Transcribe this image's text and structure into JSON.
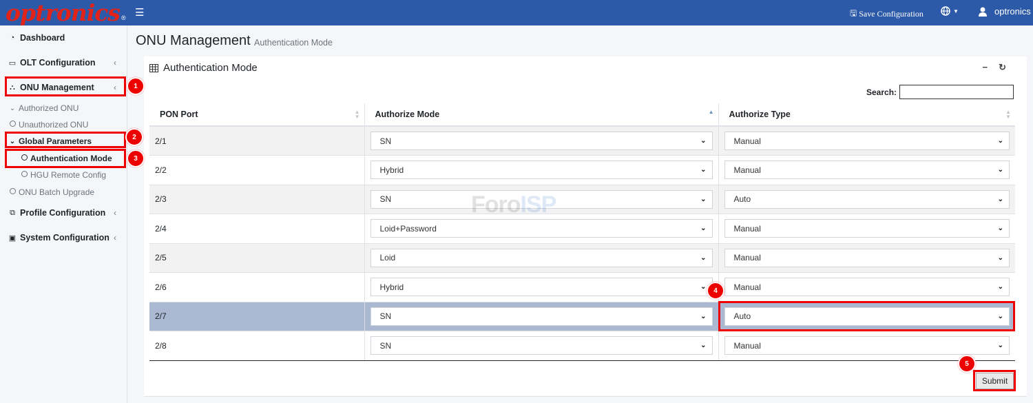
{
  "brand": {
    "logo_text": "optronics",
    "logo_mark": "®"
  },
  "header": {
    "save_label": "Save Configuration",
    "user_name": "optronics"
  },
  "sidebar": {
    "items": [
      {
        "label": "Dashboard",
        "icon": "tachometer-icon"
      },
      {
        "label": "OLT Configuration",
        "icon": "laptop-icon"
      },
      {
        "label": "ONU Management",
        "icon": "sitemap-icon"
      },
      {
        "label": "Profile Configuration",
        "icon": "copy-icon"
      },
      {
        "label": "System Configuration",
        "icon": "save-icon"
      }
    ],
    "sub": {
      "authorized_onu": "Authorized ONU",
      "unauthorized_onu": "Unauthorized ONU",
      "global_parameters": "Global Parameters",
      "authentication_mode": "Authentication Mode",
      "hgu_remote_config": "HGU Remote Config",
      "onu_batch_upgrade": "ONU Batch Upgrade"
    }
  },
  "page": {
    "title": "ONU Management",
    "subtitle": "Authentication Mode",
    "card_title": "Authentication Mode",
    "search_label": "Search:",
    "search_value": "",
    "submit_label": "Submit"
  },
  "table": {
    "headers": [
      "PON Port",
      "Authorize Mode",
      "Authorize Type"
    ],
    "rows": [
      {
        "port": "2/1",
        "mode": "SN",
        "type": "Manual"
      },
      {
        "port": "2/2",
        "mode": "Hybrid",
        "type": "Manual"
      },
      {
        "port": "2/3",
        "mode": "SN",
        "type": "Auto"
      },
      {
        "port": "2/4",
        "mode": "Loid+Password",
        "type": "Manual"
      },
      {
        "port": "2/5",
        "mode": "Loid",
        "type": "Manual"
      },
      {
        "port": "2/6",
        "mode": "Hybrid",
        "type": "Manual"
      },
      {
        "port": "2/7",
        "mode": "SN",
        "type": "Auto"
      },
      {
        "port": "2/8",
        "mode": "SN",
        "type": "Manual"
      }
    ]
  },
  "annotations": [
    "1",
    "2",
    "3",
    "4",
    "5"
  ],
  "watermark": {
    "part1": "Foro",
    "part2": "ISP"
  },
  "colors": {
    "topbar": "#2d5aa8",
    "logo": "#e2231a",
    "annotation": "#ee0000",
    "selected_row": "#aab8d1"
  }
}
